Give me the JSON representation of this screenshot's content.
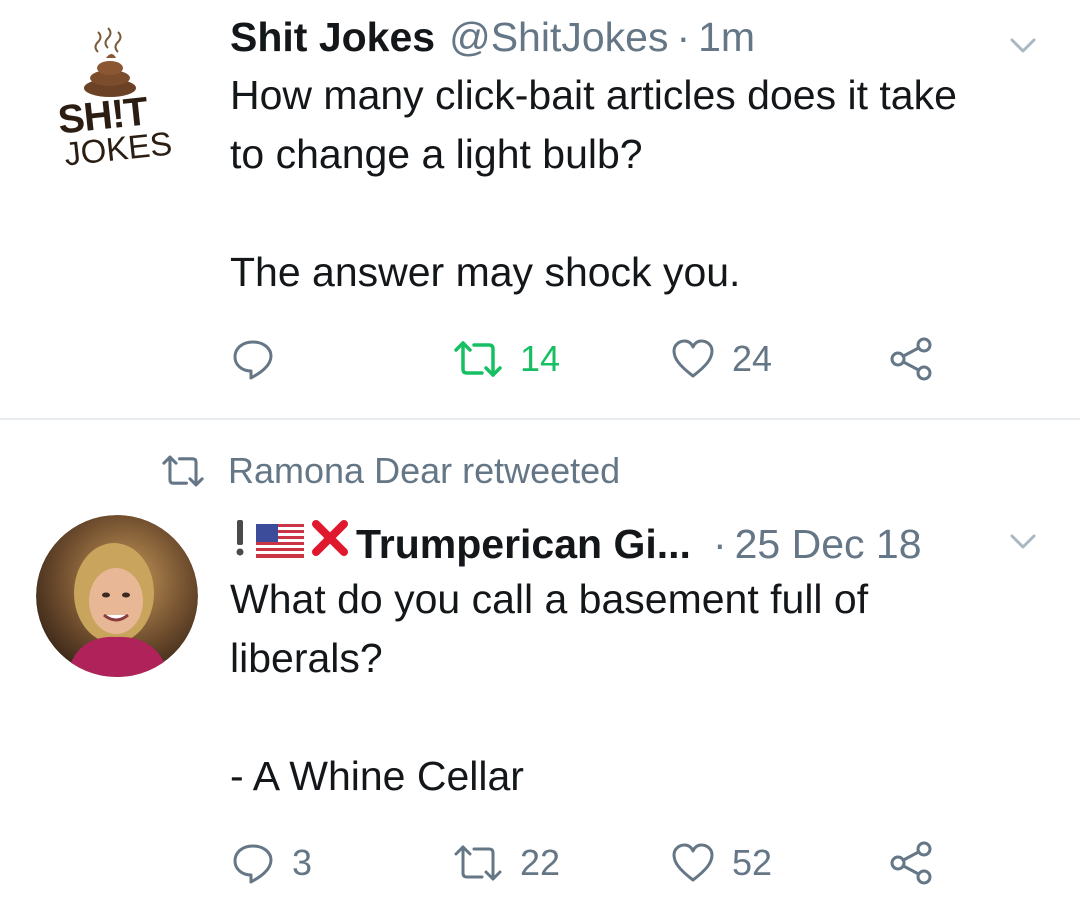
{
  "tweets": [
    {
      "author_name": "Shit Jokes",
      "handle": "@ShitJokes",
      "separator": "·",
      "time": "1m",
      "avatar": {
        "text_line1": "SH!T",
        "text_line2": "JOKES"
      },
      "text_line1": "How many click-bait articles does it take",
      "text_line2": "to change a light bulb?",
      "text_line3": "The answer may shock you.",
      "reply_count": "",
      "retweet_count": "14",
      "like_count": "24",
      "retweeted": true
    },
    {
      "context": "Ramona Dear retweeted",
      "author_name": "Trumperican Gi...",
      "name_emojis": [
        "exclamation-icon",
        "us-flag-icon",
        "cross-mark-icon"
      ],
      "separator": "·",
      "time": "25 Dec 18",
      "text_line1": "What do you call a basement full of",
      "text_line2": "liberals?",
      "text_line3": "- A Whine Cellar",
      "reply_count": "3",
      "retweet_count": "22",
      "like_count": "52",
      "retweeted": false
    }
  ],
  "colors": {
    "primary_text": "#14171a",
    "secondary_text": "#657786",
    "retweet_active": "#17bf63",
    "divider": "#e6ecf0"
  }
}
